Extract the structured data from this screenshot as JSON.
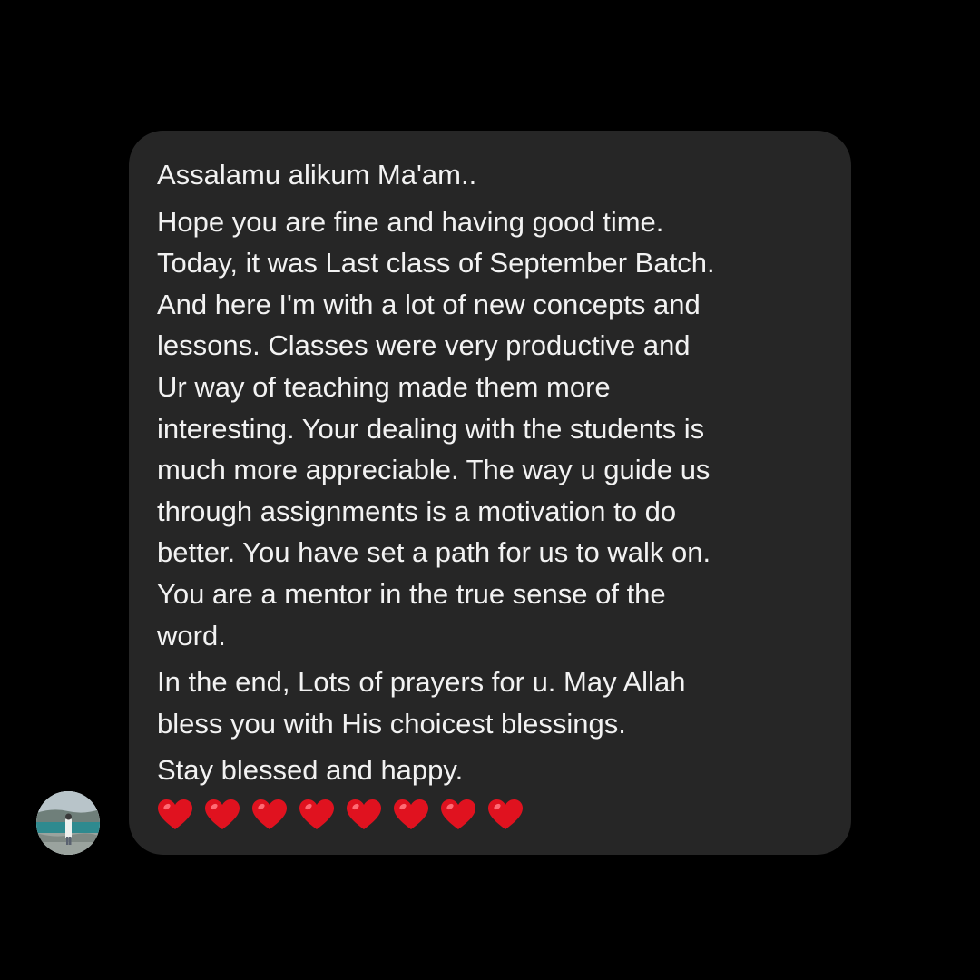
{
  "thread": {
    "sender_avatar_icon": "profile-photo-avatar",
    "message": {
      "paragraphs": [
        [
          "Assalamu alikum Ma'am.."
        ],
        [
          "Hope you are fine and having good time.",
          "Today, it was Last class of September Batch.",
          "And here I'm with a lot of new concepts and",
          "lessons. Classes were very productive and",
          "Ur way of teaching made them more",
          "interesting. Your dealing with the students is",
          "much more appreciable. The way u guide us",
          "through assignments is a motivation to do",
          "better. You have set a path for us to walk on.",
          "You are a mentor in the true sense of the",
          "word."
        ],
        [
          "In the end, Lots of prayers for u. May Allah",
          "bless you with His choicest blessings."
        ],
        [
          "Stay blessed and happy."
        ]
      ],
      "emoji_row": [
        "❤️",
        "❤️",
        "❤️",
        "❤️",
        "❤️",
        "❤️",
        "❤️",
        "❤️"
      ]
    }
  },
  "colors": {
    "background": "#000000",
    "bubble": "#262626",
    "text": "#f2f2f2",
    "heart": "#e0121f"
  }
}
